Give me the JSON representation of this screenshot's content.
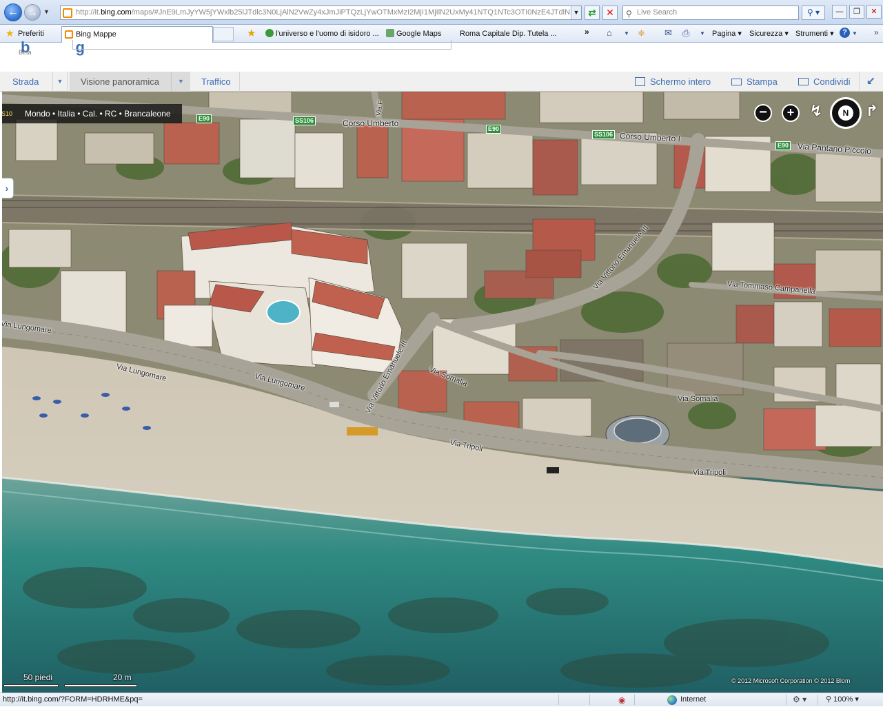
{
  "browser": {
    "url": "http://it.bing.com/maps/#JnE9bmJyYW5jYWxlb25lJTdlc3N0LjAlN2VwZy4xJmJiPTQzLjYwOTMxMzI2MjI1MjIlN2UxMy41NTQ1NTc3OTI0NzE4JTdlNDMuN",
    "url_host": "http://it.",
    "url_domain": "bing.com",
    "url_rest": "/maps/#JnE9LmJyYW5jYWxlb25lJTdlc3N0LjAlN2VwZy4xJmJiPTQzLjYwOTMxMzI2MjI1MjIlN2UxMy41NTQ1NTc3OTI0NzE4JTdlNDMuN",
    "search_placeholder": "Live Search",
    "favorites_label": "Preferiti",
    "active_tab_title": "Bing Mappe",
    "favorites_links": [
      "l'universo e l'uomo di isidoro ...",
      "Google Maps",
      "Roma Capitale  Dip. Tutela ..."
    ],
    "commands": {
      "page": "Pagina",
      "safety": "Sicurezza",
      "tools": "Strumenti"
    },
    "status_url": "http://it.bing.com/?FORM=HDRHME&pq=",
    "status_zone": "Internet",
    "status_zoom": "100%"
  },
  "bing": {
    "beta_label": "Beta"
  },
  "toolbar": {
    "road_label": "Strada",
    "birdseye_label": "Visione panoramica",
    "traffic_label": "Traffico",
    "fullscreen_label": "Schermo intero",
    "print_label": "Stampa",
    "share_label": "Condividi"
  },
  "map": {
    "breadcrumb": "Mondo • Italia • Cal. • RC • Brancaleone",
    "left_edge_text": "S10",
    "shields": [
      "E90",
      "SS106",
      "E90",
      "SS106",
      "E90"
    ],
    "road_labels": [
      "Corso Umberto",
      "Corso Umberto I",
      "Via Pantano Piccolo",
      "Via F",
      "Via Vittorio Emanuele III",
      "Via Tommaso Campanella",
      "Via Lungomare",
      "Via Lungomare",
      "Via Lungomare",
      "Via Vittorio Emanuele III",
      "Via Somalia",
      "Via Somalia",
      "Via Tripoli",
      "Via Tripoli"
    ],
    "compass_label": "N",
    "scale_feet": "50 piedi",
    "scale_meters": "20 m",
    "copyright": "© 2012 Microsoft Corporation   © 2012 Blom"
  },
  "colors": {
    "accent_link": "#3b6db1",
    "map_sea": "#2f7f78",
    "map_beach": "#d8cfbf",
    "roof_red": "#b5574a"
  }
}
